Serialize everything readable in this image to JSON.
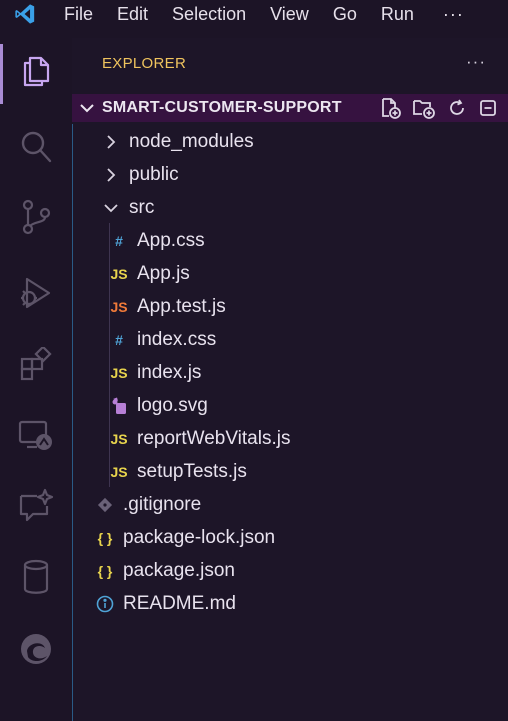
{
  "menubar": {
    "app_icon": "vscode-logo-icon",
    "items": [
      "File",
      "Edit",
      "Selection",
      "View",
      "Go",
      "Run"
    ],
    "more": "···"
  },
  "activitybar": {
    "items": [
      {
        "name": "explorer-icon",
        "active": true
      },
      {
        "name": "search-icon"
      },
      {
        "name": "source-control-icon"
      },
      {
        "name": "run-debug-icon"
      },
      {
        "name": "extensions-icon"
      },
      {
        "name": "remote-explorer-icon"
      },
      {
        "name": "chat-icon"
      },
      {
        "name": "database-icon"
      },
      {
        "name": "edge-devtools-icon"
      }
    ]
  },
  "sidebar": {
    "title": "EXPLORER",
    "more": "···",
    "folder": {
      "name": "SMART-CUSTOMER-SUPPORT",
      "actions": [
        "new-file-icon",
        "new-folder-icon",
        "refresh-icon",
        "collapse-all-icon"
      ]
    },
    "tree": [
      {
        "label": "node_modules",
        "type": "folder",
        "expanded": false
      },
      {
        "label": "public",
        "type": "folder",
        "expanded": false
      },
      {
        "label": "src",
        "type": "folder",
        "expanded": true
      },
      {
        "label": "App.css",
        "type": "css",
        "icon_text": "#"
      },
      {
        "label": "App.js",
        "type": "js",
        "icon_text": "JS"
      },
      {
        "label": "App.test.js",
        "type": "test",
        "icon_text": "JS"
      },
      {
        "label": "index.css",
        "type": "css",
        "icon_text": "#"
      },
      {
        "label": "index.js",
        "type": "js",
        "icon_text": "JS"
      },
      {
        "label": "logo.svg",
        "type": "svg"
      },
      {
        "label": "reportWebVitals.js",
        "type": "js",
        "icon_text": "JS"
      },
      {
        "label": "setupTests.js",
        "type": "js",
        "icon_text": "JS"
      },
      {
        "label": ".gitignore",
        "type": "git"
      },
      {
        "label": "package-lock.json",
        "type": "json",
        "icon_text": "{ }"
      },
      {
        "label": "package.json",
        "type": "json",
        "icon_text": "{ }"
      },
      {
        "label": "README.md",
        "type": "info"
      }
    ]
  },
  "colors": {
    "background": "#1c1426",
    "title_accent": "#f0c45e",
    "folder_header_bg": "#361240",
    "active_indicator": "#a98cd4"
  }
}
